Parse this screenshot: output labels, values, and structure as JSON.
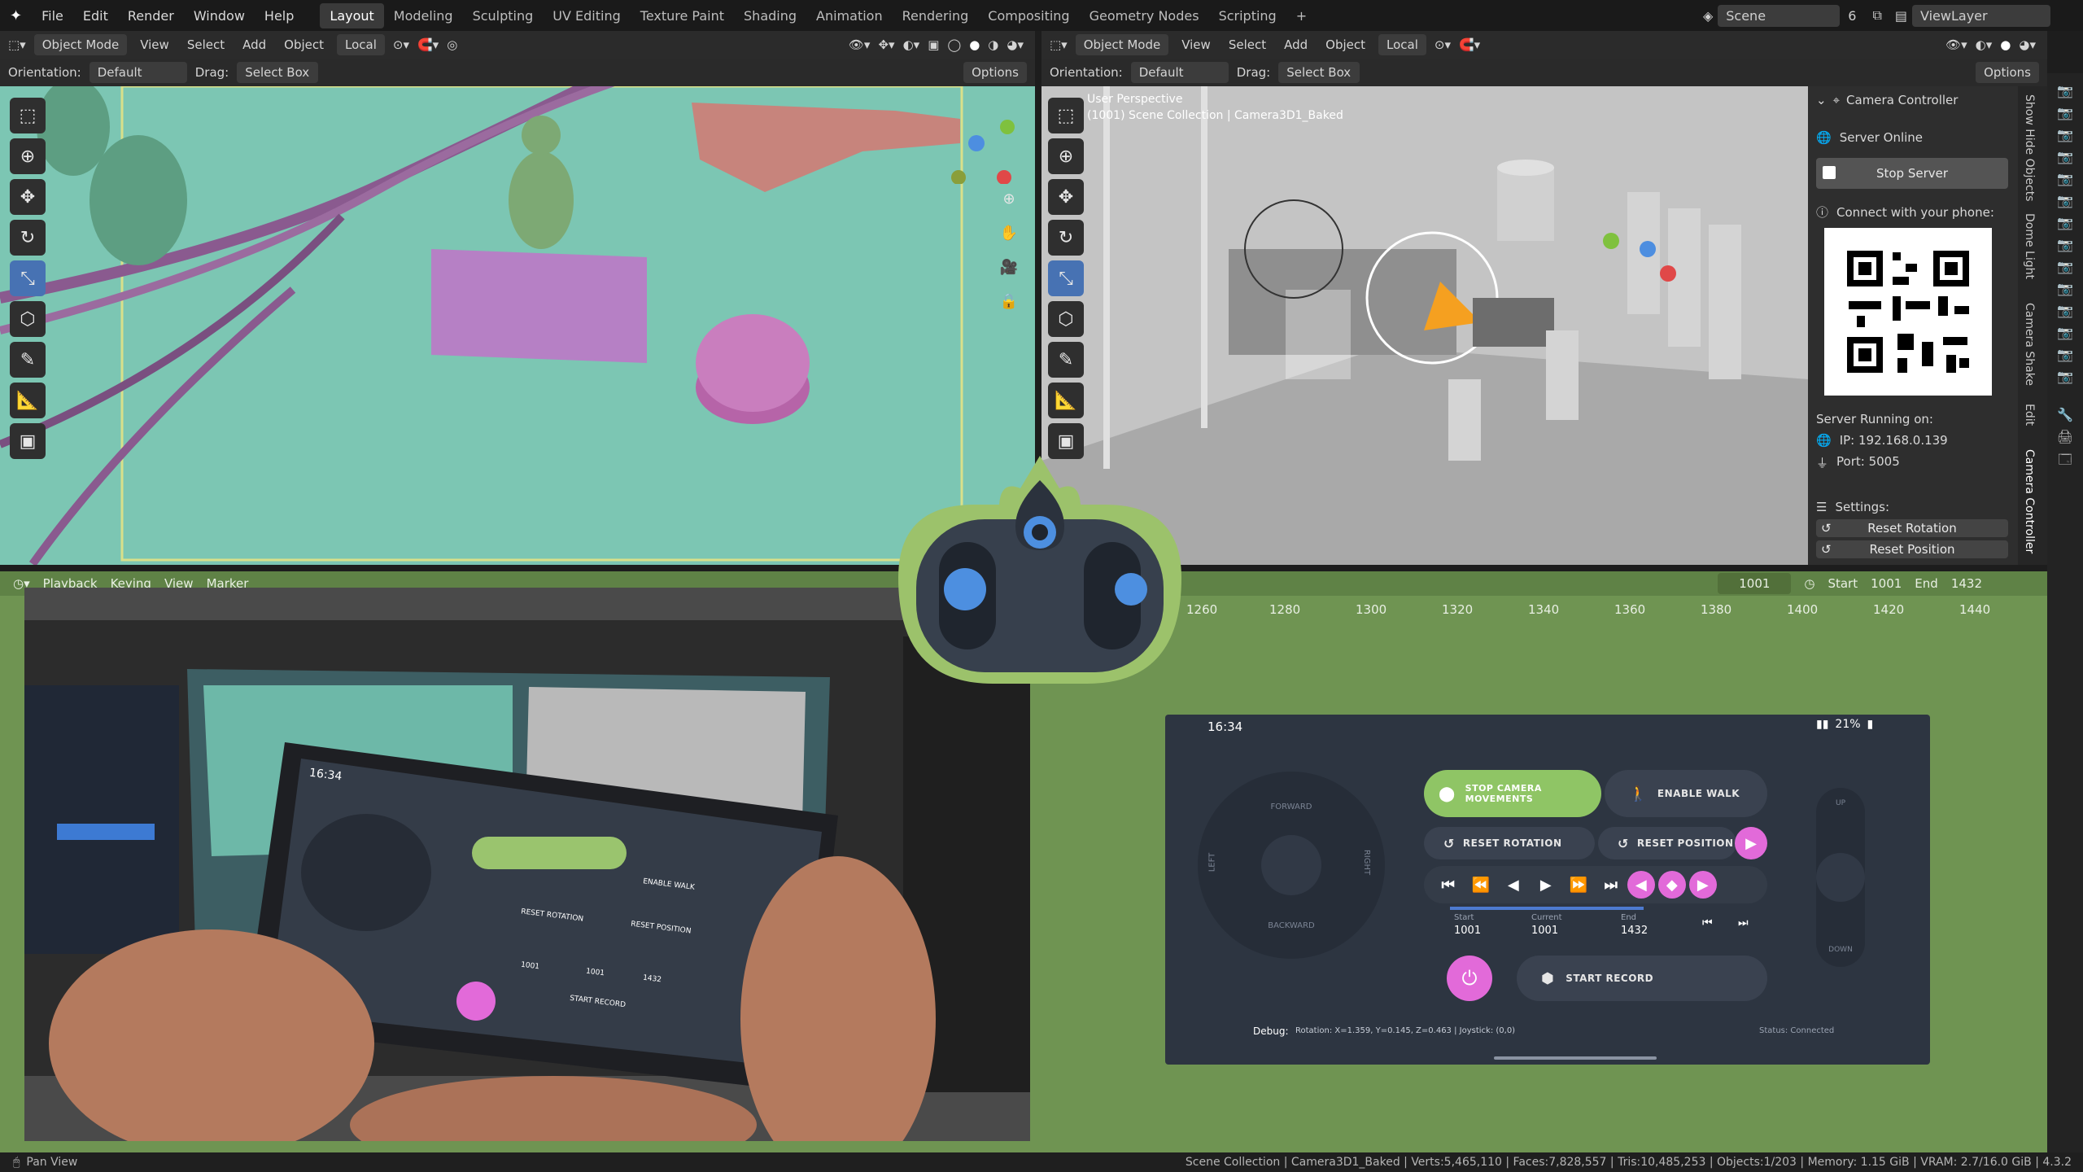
{
  "topbar": {
    "menus": [
      "File",
      "Edit",
      "Render",
      "Window",
      "Help"
    ],
    "workspaces": [
      "Layout",
      "Modeling",
      "Sculpting",
      "UV Editing",
      "Texture Paint",
      "Shading",
      "Animation",
      "Rendering",
      "Compositing",
      "Geometry Nodes",
      "Scripting"
    ],
    "active_workspace": "Layout",
    "add_tab": "+",
    "scene_label": "Scene",
    "scene_count": "6",
    "viewlayer_label": "ViewLayer"
  },
  "left_viewport": {
    "mode": "Object Mode",
    "menus": [
      "View",
      "Select",
      "Add",
      "Object"
    ],
    "transform": "Local",
    "orientation_label": "Orientation:",
    "orientation_value": "Default",
    "drag_label": "Drag:",
    "drag_value": "Select Box",
    "options": "Options"
  },
  "right_viewport": {
    "mode": "Object Mode",
    "menus": [
      "View",
      "Select",
      "Add",
      "Object"
    ],
    "transform": "Local",
    "orientation_label": "Orientation:",
    "orientation_value": "Default",
    "drag_label": "Drag:",
    "drag_value": "Select Box",
    "options": "Options",
    "overlay_line1": "User Perspective",
    "overlay_line2": "(1001) Scene Collection | Camera3D1_Baked"
  },
  "camera_panel": {
    "title": "Camera Controller",
    "server_status": "Server Online",
    "stop_server": "Stop Server",
    "connect_text": "Connect with your phone:",
    "running_on": "Server Running on:",
    "ip": "IP: 192.168.0.139",
    "port": "Port: 5005",
    "settings": "Settings:",
    "reset_rotation": "Reset Rotation",
    "reset_position": "Reset Position"
  },
  "side_tabs": [
    "Show Hide Objects",
    "Dome Light",
    "Camera Shake",
    "Edit",
    "Camera Controller"
  ],
  "timeline": {
    "menus": [
      "Playback",
      "Keying",
      "View",
      "Marker"
    ],
    "current_frame": "1001",
    "start_label": "Start",
    "start": "1001",
    "end_label": "End",
    "end": "1432",
    "ruler": [
      "1260",
      "1280",
      "1300",
      "1320",
      "1340",
      "1360",
      "1380",
      "1400",
      "1420",
      "1440"
    ]
  },
  "phone": {
    "time": "16:34",
    "battery": "21%",
    "joystick_labels": {
      "forward": "FORWARD",
      "backward": "BACKWARD",
      "left": "LEFT",
      "right": "RIGHT"
    },
    "updown_labels": {
      "up": "UP",
      "down": "DOWN"
    },
    "stop_camera": "STOP CAMERA MOVEMENTS",
    "enable_walk": "ENABLE WALK",
    "reset_rotation": "RESET ROTATION",
    "reset_position": "RESET POSITION",
    "start_label": "Start",
    "start_value": "1001",
    "current_label": "Current",
    "current_value": "1001",
    "end_label": "End",
    "end_value": "1432",
    "start_record": "START RECORD",
    "debug_label": "Debug:",
    "debug_text": "Rotation: X=1.359, Y=0.145, Z=0.463 | Joystick: (0,0)",
    "status": "Status: Connected"
  },
  "photo_phone": {
    "time": "16:34",
    "reset_rotation": "RESET ROTATION",
    "reset_position": "RESET POSITION",
    "enable_walk": "ENABLE WALK",
    "start_record": "START RECORD",
    "start_value": "1001",
    "current_value": "1001",
    "end_value": "1432"
  },
  "statusbar": {
    "left": "Pan View",
    "right": "Scene Collection | Camera3D1_Baked | Verts:5,465,110 | Faces:7,828,557 | Tris:10,485,253 | Objects:1/203 | Memory: 1.15 GiB | VRAM: 2.7/16.0 GiB | 4.3.2"
  },
  "colors": {
    "accent_blue": "#4772b3",
    "logo_green": "#9cc26b",
    "phone_green": "#8fc565",
    "phone_pink": "#e26ad9",
    "timeline_green": "#6f9452"
  }
}
